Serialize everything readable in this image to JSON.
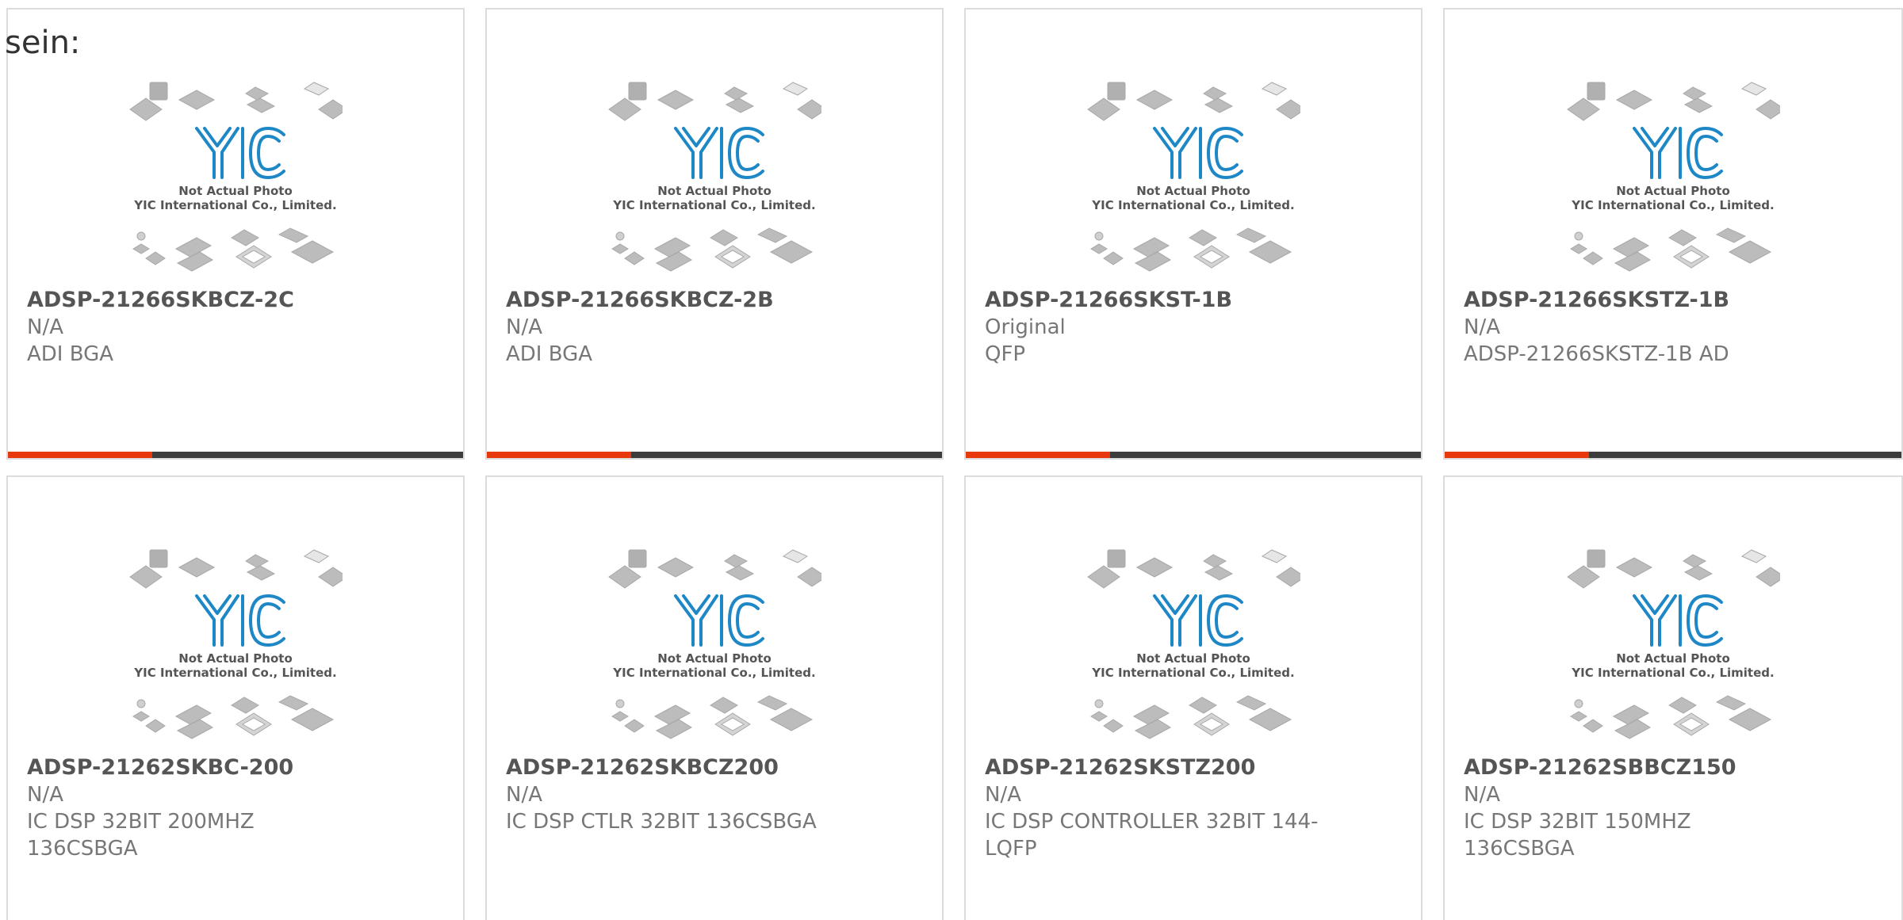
{
  "intro_text": "sein:",
  "colors": {
    "accent": "#e8380d",
    "bar": "#3c3c3c",
    "logo": "#1e88c7",
    "chip": "#bdbdbd"
  },
  "placeholder": {
    "logo_text": "YIC",
    "caption_line1": "Not Actual Photo",
    "caption_line2": "YIC International Co., Limited."
  },
  "products": [
    {
      "part": "ADSP-21266SKBCZ-2C",
      "condition": "N/A",
      "description": "ADI BGA"
    },
    {
      "part": "ADSP-21266SKBCZ-2B",
      "condition": "N/A",
      "description": "ADI BGA"
    },
    {
      "part": "ADSP-21266SKST-1B",
      "condition": "Original",
      "description": "QFP"
    },
    {
      "part": "ADSP-21266SKSTZ-1B",
      "condition": "N/A",
      "description": "ADSP-21266SKSTZ-1B AD"
    },
    {
      "part": "ADSP-21262SKBC-200",
      "condition": "N/A",
      "description": "IC DSP 32BIT 200MHZ 136CSBGA"
    },
    {
      "part": "ADSP-21262SKBCZ200",
      "condition": "N/A",
      "description": "IC DSP CTLR 32BIT 136CSBGA"
    },
    {
      "part": "ADSP-21262SKSTZ200",
      "condition": "N/A",
      "description": "IC DSP CONTROLLER 32BIT 144-LQFP"
    },
    {
      "part": "ADSP-21262SBBCZ150",
      "condition": "N/A",
      "description": "IC DSP 32BIT 150MHZ 136CSBGA"
    }
  ]
}
